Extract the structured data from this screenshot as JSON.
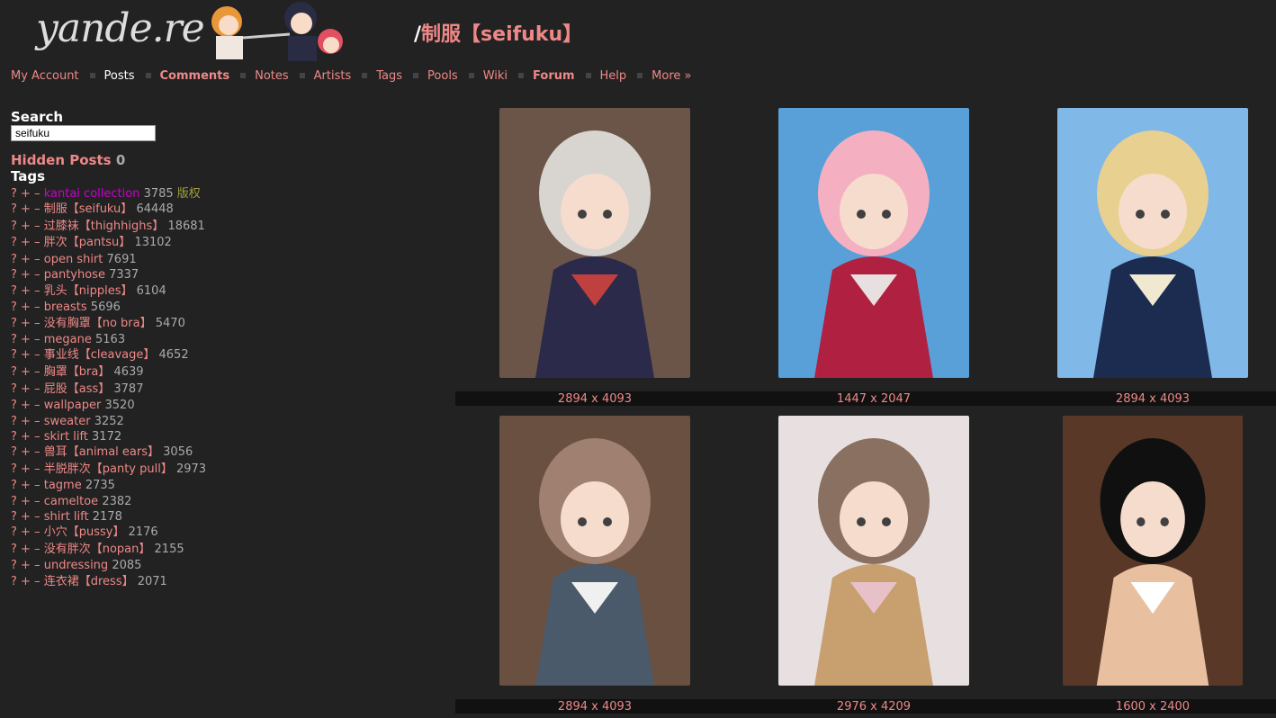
{
  "site": {
    "logo": "yande.re"
  },
  "page_title": {
    "slash": "/",
    "tag": "制服【seifuku】"
  },
  "menu": [
    {
      "label": "My Account",
      "current": false,
      "bold": false
    },
    {
      "label": "Posts",
      "current": true,
      "bold": false
    },
    {
      "label": "Comments",
      "current": false,
      "bold": true
    },
    {
      "label": "Notes",
      "current": false,
      "bold": false
    },
    {
      "label": "Artists",
      "current": false,
      "bold": false
    },
    {
      "label": "Tags",
      "current": false,
      "bold": false
    },
    {
      "label": "Pools",
      "current": false,
      "bold": false
    },
    {
      "label": "Wiki",
      "current": false,
      "bold": false
    },
    {
      "label": "Forum",
      "current": false,
      "bold": true
    },
    {
      "label": "Help",
      "current": false,
      "bold": false
    },
    {
      "label": "More »",
      "current": false,
      "bold": false
    }
  ],
  "sidebar": {
    "search_heading": "Search",
    "search_value": "seifuku",
    "hidden_posts_label": "Hidden Posts",
    "hidden_posts_count": "0",
    "tags_heading": "Tags",
    "tags": [
      {
        "name": "kantai collection",
        "count": "3785",
        "type": "版权",
        "copyright": true
      },
      {
        "name": "制服【seifuku】",
        "count": "64448"
      },
      {
        "name": "过膝袜【thighhighs】",
        "count": "18681"
      },
      {
        "name": "胖次【pantsu】",
        "count": "13102"
      },
      {
        "name": "open shirt",
        "count": "7691"
      },
      {
        "name": "pantyhose",
        "count": "7337"
      },
      {
        "name": "乳头【nipples】",
        "count": "6104"
      },
      {
        "name": "breasts",
        "count": "5696"
      },
      {
        "name": "没有胸罩【no bra】",
        "count": "5470"
      },
      {
        "name": "megane",
        "count": "5163"
      },
      {
        "name": "事业线【cleavage】",
        "count": "4652"
      },
      {
        "name": "胸罩【bra】",
        "count": "4639"
      },
      {
        "name": "屁股【ass】",
        "count": "3787"
      },
      {
        "name": "wallpaper",
        "count": "3520"
      },
      {
        "name": "sweater",
        "count": "3252"
      },
      {
        "name": "skirt lift",
        "count": "3172"
      },
      {
        "name": "兽耳【animal ears】",
        "count": "3056"
      },
      {
        "name": "半脱胖次【panty pull】",
        "count": "2973"
      },
      {
        "name": "tagme",
        "count": "2735"
      },
      {
        "name": "cameltoe",
        "count": "2382"
      },
      {
        "name": "shirt lift",
        "count": "2178"
      },
      {
        "name": "小穴【pussy】",
        "count": "2176"
      },
      {
        "name": "没有胖次【nopan】",
        "count": "2155"
      },
      {
        "name": "undressing",
        "count": "2085"
      },
      {
        "name": "连衣裙【dress】",
        "count": "2071"
      }
    ]
  },
  "posts": [
    {
      "dims": "2894 x 4093",
      "palette": [
        "#6b5548",
        "#d8d4d0",
        "#2c2a4a",
        "#c04040"
      ]
    },
    {
      "dims": "1447 x 2047",
      "palette": [
        "#5aa0d8",
        "#f4b0c0",
        "#b02040",
        "#e8e0e0"
      ]
    },
    {
      "dims": "2894 x 4093",
      "palette": [
        "#80b8e8",
        "#e8d090",
        "#1c2c50",
        "#f0e8d0"
      ]
    },
    {
      "dims": "2894 x 4093",
      "palette": [
        "#6a5040",
        "#a08070",
        "#4a5a6a",
        "#f0f0f0"
      ]
    },
    {
      "dims": "2976 x 4209",
      "palette": [
        "#e8e0e0",
        "#8a7060",
        "#c8a070",
        "#e8c0c8"
      ]
    },
    {
      "dims": "1600 x 2400",
      "palette": [
        "#5a3828",
        "#101010",
        "#e8c0a0",
        "#ffffff"
      ]
    }
  ],
  "colors": {
    "background": "#222222",
    "link": "#ee8887",
    "copyright_tag": "#cc00cc",
    "count": "#aaaaaa"
  }
}
